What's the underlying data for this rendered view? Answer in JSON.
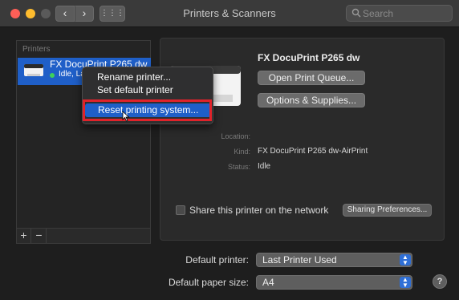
{
  "window": {
    "title": "Printers & Scanners",
    "search_placeholder": "Search",
    "nav_back": "‹",
    "nav_forward": "›",
    "grid": "⋮⋮⋮"
  },
  "sidebar": {
    "header": "Printers",
    "printers": [
      {
        "name": "FX DocuPrint P265 dw",
        "status": "Idle, La"
      }
    ],
    "add_label": "+",
    "remove_label": "−"
  },
  "context_menu": {
    "items": [
      "Rename printer...",
      "Set default printer",
      "Reset printing system..."
    ]
  },
  "detail": {
    "printer_title": "FX DocuPrint P265 dw",
    "open_queue_label": "Open Print Queue...",
    "options_label": "Options & Supplies...",
    "location_label": "Location:",
    "location_value": "",
    "kind_label": "Kind:",
    "kind_value": "FX DocuPrint P265 dw-AirPrint",
    "status_label": "Status:",
    "status_value": "Idle",
    "share_label": "Share this printer on the network",
    "share_checked": false,
    "sharing_prefs_label": "Sharing Preferences..."
  },
  "defaults": {
    "printer_label": "Default printer:",
    "printer_value": "Last Printer Used",
    "paper_label": "Default paper size:",
    "paper_value": "A4",
    "help_label": "?"
  },
  "colors": {
    "selection": "#1f5fc8",
    "highlight_box": "#e0232a",
    "status_dot": "#3ed15a"
  }
}
